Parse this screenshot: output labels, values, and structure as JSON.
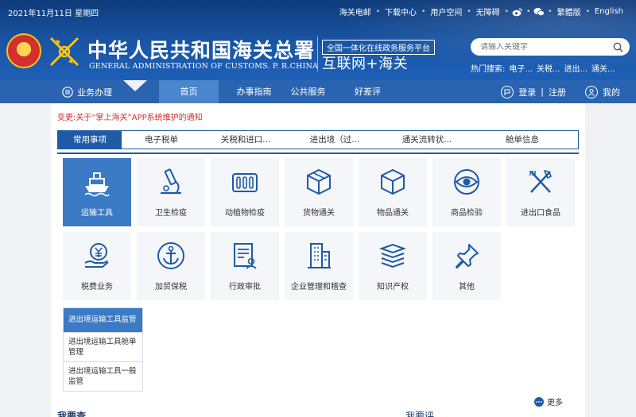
{
  "topbar": {
    "date": "2021年11月11日  星期四",
    "links": [
      {
        "label": "海关电邮",
        "name": "link-customs-email"
      },
      {
        "label": "下载中心",
        "name": "link-download-center"
      },
      {
        "label": "用户空间",
        "name": "link-user-space"
      },
      {
        "label": "无障碍",
        "name": "link-accessibility"
      }
    ],
    "traditional": "繁體版",
    "english": "English"
  },
  "brand": {
    "title_cn": "中华人民共和国海关总署",
    "title_en": "GENERAL ADMINISTRATION OF CUSTOMS. P. R.CHINA",
    "platform": "全国一体化在线政务服务平台",
    "slogan": "互联网+海关"
  },
  "search": {
    "placeholder": "请输入关键字",
    "hot_label": "热门搜索:",
    "hot_items": [
      "电子...",
      "关税...",
      "进出...",
      "通关..."
    ]
  },
  "nav": {
    "menu_label": "业务办理",
    "items": [
      "首页",
      "办事指南",
      "公共服务",
      "好差评"
    ],
    "login": "登录",
    "sep": "|",
    "register": "注册",
    "mine": "我的"
  },
  "notice": "变更:关于“掌上海关”APP系统维护的通知",
  "tabs": [
    "常用事项",
    "电子税单",
    "关税和进口...",
    "进出境（过...",
    "通关流转状...",
    "舱单信息"
  ],
  "tiles": [
    {
      "label": "运输工具",
      "icon": "ship-icon"
    },
    {
      "label": "卫生检疫",
      "icon": "microscope-icon"
    },
    {
      "label": "动植物检疫",
      "icon": "plant-quarantine-icon"
    },
    {
      "label": "货物通关",
      "icon": "cargo-box-icon"
    },
    {
      "label": "物品通关",
      "icon": "package-cube-icon"
    },
    {
      "label": "商品检验",
      "icon": "eye-inspection-icon"
    },
    {
      "label": "进出口食品",
      "icon": "fork-knife-icon"
    },
    {
      "label": "税费业务",
      "icon": "yuan-hand-icon"
    },
    {
      "label": "加贸保税",
      "icon": "anchor-icon"
    },
    {
      "label": "行政审批",
      "icon": "document-approval-icon"
    },
    {
      "label": "企业管理和稽查",
      "icon": "building-icon"
    },
    {
      "label": "知识产权",
      "icon": "books-stack-icon"
    },
    {
      "label": "其他",
      "icon": "pin-icon"
    }
  ],
  "submenu": {
    "header": "进出境运输工具监管",
    "items": [
      "进出境运输工具舱单管理",
      "进出境运输工具一般监管"
    ]
  },
  "more": "更多",
  "bottom": {
    "left": "我要查",
    "right": "我要评"
  },
  "colors": {
    "header_dark": "#0f3b7a",
    "nav": "#2a64b0",
    "accent": "#1f5aa6",
    "active_tile": "#3b7ac4",
    "notice": "#d32f2f"
  }
}
